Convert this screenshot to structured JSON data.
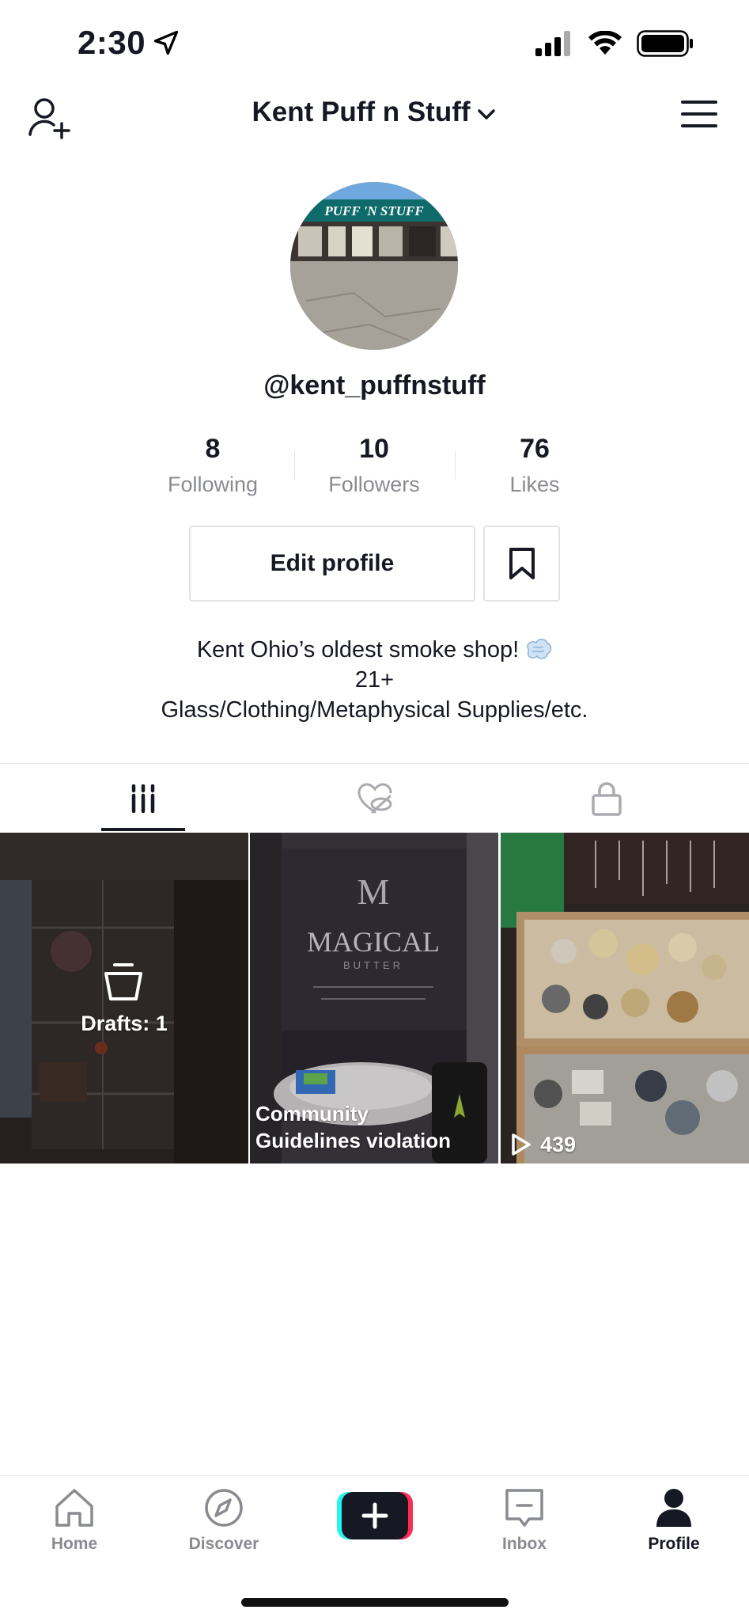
{
  "status_bar": {
    "time": "2:30"
  },
  "header": {
    "title": "Kent Puff n Stuff"
  },
  "profile": {
    "avatar_sign_text": "PUFF 'N STUFF",
    "username": "@kent_puffnstuff",
    "stats": [
      {
        "value": "8",
        "label": "Following"
      },
      {
        "value": "10",
        "label": "Followers"
      },
      {
        "value": "76",
        "label": "Likes"
      }
    ],
    "edit_label": "Edit profile",
    "bio": [
      "Kent Ohio’s oldest smoke shop!",
      "21+",
      "Glass/Clothing/Metaphysical Supplies/etc."
    ]
  },
  "tabs": [
    {
      "icon": "grid-icon",
      "active": true
    },
    {
      "icon": "hidden-liked-icon",
      "active": false
    },
    {
      "icon": "lock-icon",
      "active": false
    }
  ],
  "videos": [
    {
      "label": "Drafts: 1"
    },
    {
      "label_lines": [
        "Community",
        "Guidelines violation"
      ],
      "sign_text": "MAGICAL",
      "sign_sub": "BUTTER"
    },
    {
      "views": "439"
    }
  ],
  "bottom_nav": [
    {
      "label": "Home",
      "icon": "home-icon"
    },
    {
      "label": "Discover",
      "icon": "compass-icon"
    },
    {
      "label": "",
      "icon": "plus-icon"
    },
    {
      "label": "Inbox",
      "icon": "inbox-icon"
    },
    {
      "label": "Profile",
      "icon": "person-icon",
      "active": true
    }
  ],
  "colors": {
    "text": "#161823",
    "muted": "#8a8b91",
    "create_cyan": "#25f4ee",
    "create_pink": "#fe2c55"
  }
}
